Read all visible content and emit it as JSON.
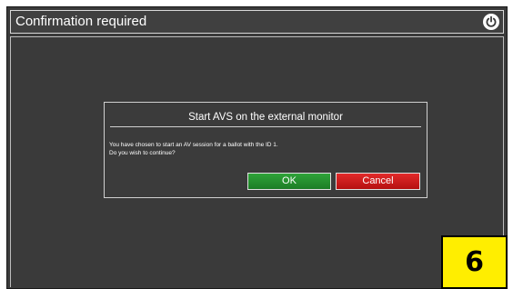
{
  "window": {
    "title": "Confirmation required",
    "power_icon": "power-icon"
  },
  "dialog": {
    "title": "Start AVS on the external monitor",
    "message_line1": "You have chosen to start an AV session for a ballot with the ID 1.",
    "message_line2": "Do you wish to continue?",
    "ok_label": "OK",
    "cancel_label": "Cancel"
  },
  "badge": {
    "number": "6"
  },
  "colors": {
    "background": "#3a3a3a",
    "ok_button": "#2fa339",
    "cancel_button": "#e22a2a",
    "badge": "#ffee00"
  }
}
